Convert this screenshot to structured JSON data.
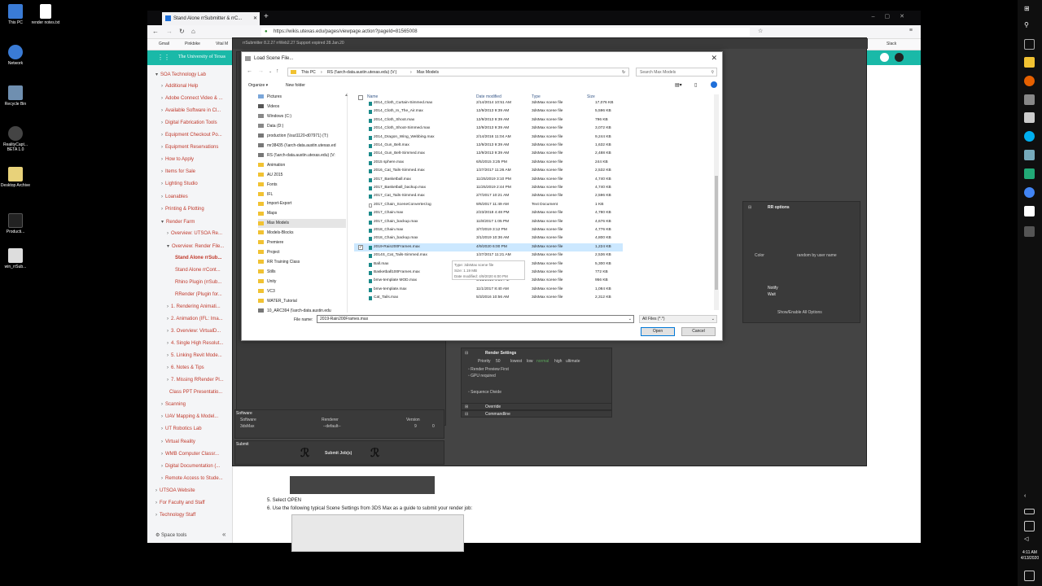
{
  "desktop": {
    "icons": [
      {
        "label": "This PC",
        "icon": "monitor-icon",
        "color": "#3a7bd5"
      },
      {
        "label": "Network",
        "icon": "network-icon",
        "color": "#3a7bd5"
      },
      {
        "label": "Recycle Bin",
        "icon": "recycle-bin-icon",
        "color": "#6f8fb0"
      },
      {
        "label": "RealityCapt... BETA 1.0",
        "icon": "realitycapture-icon",
        "color": "#444"
      },
      {
        "label": "Desktop Archive",
        "icon": "folder-icon",
        "color": "#e8d27a"
      },
      {
        "label": "Producti...",
        "icon": "app-icon",
        "color": "#222"
      },
      {
        "label": "win_rrSub...",
        "icon": "rrsubmitter-icon",
        "color": "#ddd"
      }
    ],
    "file_icon": {
      "label": "render notes.txt",
      "icon": "text-file-icon"
    }
  },
  "taskbar": {
    "clock_time": "4:11 AM",
    "clock_date": "4/13/2020"
  },
  "browser": {
    "tab_title": "Stand Alone rrSubmitter & rrC...",
    "new_tab": "+",
    "url": "https://wikis.utexas.edu/pages/viewpage.action?pageId=81565008",
    "bookmarks": [
      "Gmail",
      "Pinkbike",
      "Vital M"
    ],
    "slack_label": "Slack"
  },
  "wiki": {
    "header_title": "The University of Texas",
    "sidebar": [
      {
        "label": "SOA Technology Lab",
        "indent": 0,
        "arrow": "▾"
      },
      {
        "label": "Additional Help",
        "indent": 1,
        "arrow": "›"
      },
      {
        "label": "Adobe Connect Video & ...",
        "indent": 1,
        "arrow": "›"
      },
      {
        "label": "Available Software in Cl...",
        "indent": 1,
        "arrow": "›"
      },
      {
        "label": "Digital Fabrication Tools",
        "indent": 1,
        "arrow": "›"
      },
      {
        "label": "Equipment Checkout Po...",
        "indent": 1,
        "arrow": "›"
      },
      {
        "label": "Equipment Reservations",
        "indent": 1,
        "arrow": "›"
      },
      {
        "label": "How to Apply",
        "indent": 1,
        "arrow": "›"
      },
      {
        "label": "Items for Sale",
        "indent": 1,
        "arrow": "›"
      },
      {
        "label": "Lighting Studio",
        "indent": 1,
        "arrow": "›"
      },
      {
        "label": "Loanables",
        "indent": 1,
        "arrow": "›"
      },
      {
        "label": "Printing & Plotting",
        "indent": 1,
        "arrow": "›"
      },
      {
        "label": "Render Farm",
        "indent": 1,
        "arrow": "▾"
      },
      {
        "label": "Overview: UTSOA Re...",
        "indent": 2,
        "arrow": "›"
      },
      {
        "label": "Overview: Render File...",
        "indent": 2,
        "arrow": "▾"
      },
      {
        "label": "Stand Alone rrSub...",
        "indent": 3,
        "arrow": "",
        "bold": true
      },
      {
        "label": "Stand Alone rrCont...",
        "indent": 3,
        "arrow": ""
      },
      {
        "label": "Rhino Plugin (rrSub...",
        "indent": 3,
        "arrow": ""
      },
      {
        "label": "RRender (Plugin for...",
        "indent": 3,
        "arrow": ""
      },
      {
        "label": "1. Rendering Animati...",
        "indent": 2,
        "arrow": "›"
      },
      {
        "label": "2. Animation (IFL: Ima...",
        "indent": 2,
        "arrow": "›"
      },
      {
        "label": "3. Overview: VirtualD...",
        "indent": 2,
        "arrow": "›"
      },
      {
        "label": "4. Single High Resolut...",
        "indent": 2,
        "arrow": "›"
      },
      {
        "label": "5. Linking Revit Mode...",
        "indent": 2,
        "arrow": "›"
      },
      {
        "label": "6. Notes & Tips",
        "indent": 2,
        "arrow": "›"
      },
      {
        "label": "7. Missing RRender Pl...",
        "indent": 2,
        "arrow": "›"
      },
      {
        "label": "Class PPT Presentatio...",
        "indent": 2,
        "arrow": ""
      },
      {
        "label": "Scanning",
        "indent": 1,
        "arrow": "›"
      },
      {
        "label": "UAV Mapping & Model...",
        "indent": 1,
        "arrow": "›"
      },
      {
        "label": "UT Robotics Lab",
        "indent": 1,
        "arrow": "›"
      },
      {
        "label": "Virtual Reality",
        "indent": 1,
        "arrow": "›"
      },
      {
        "label": "WMB Computer Classr...",
        "indent": 1,
        "arrow": "›"
      },
      {
        "label": "Digital Documentation (...",
        "indent": 1,
        "arrow": "›"
      },
      {
        "label": "Remote Access to Stude...",
        "indent": 1,
        "arrow": "›"
      },
      {
        "label": "UTSOA Website",
        "indent": 0,
        "arrow": "›"
      },
      {
        "label": "For Faculty and Staff",
        "indent": 0,
        "arrow": "›"
      },
      {
        "label": "Technology Staff",
        "indent": 0,
        "arrow": "›"
      }
    ],
    "space_tools": "Space tools",
    "step5": "5. Select OPEN",
    "step6": "6. Use the following typical Scene Settings from 3DS Max as a guide to submit your render job:"
  },
  "rrsubmitter": {
    "title": "rrSubmitter  8.2.27     rrWeb2.27     Support expired 28.Jan.20",
    "rr_options": "RR options",
    "color_label": "Color",
    "color_value": "random by user name",
    "notify": "Notify",
    "wait": "Wait",
    "show_enable_all": "Show/Enable All Options",
    "render_settings": "Render Settings",
    "priority_label": "Priority",
    "priority_value": "50",
    "priority_levels": [
      "lowest",
      "low",
      "normal",
      "high",
      "ultimate"
    ],
    "render_preview_first": "Render Preview First",
    "gpu_required": "GPU required",
    "sequence_divide": "Sequence Divide",
    "override": "Override",
    "commandline": "Commandline",
    "software_section": "Software",
    "software_label": "Software",
    "software_value": "3dsMax",
    "renderer_label": "Renderer",
    "renderer_value": "--default--",
    "version_label": "Version",
    "version_value": "9",
    "version_value2": "0",
    "submit_section": "Submit",
    "submit_button": "Submit Job(s)"
  },
  "dialog": {
    "title": "Load Scene File...",
    "breadcrumb": [
      "This PC",
      "RS (\\\\arch-data.austin.utexas.edu) (V:)",
      "Max Models"
    ],
    "search_placeholder": "Search Max Models",
    "organize": "Organize ▾",
    "new_folder": "New folder",
    "tree": [
      {
        "label": "Pictures",
        "kind": "pictures"
      },
      {
        "label": "Videos",
        "kind": "videos"
      },
      {
        "label": "Windows (C:)",
        "kind": "drive"
      },
      {
        "label": "Data (D:)",
        "kind": "drive"
      },
      {
        "label": "production (\\\\sut1120-d07971) (T:)",
        "kind": "net"
      },
      {
        "label": "mr38435 (\\\\arch-data.austin.utexas.ed",
        "kind": "net"
      },
      {
        "label": "RS (\\\\arch-data.austin.utexas.edu) (V:",
        "kind": "net"
      },
      {
        "label": "Animation",
        "kind": "folder"
      },
      {
        "label": "AU 2015",
        "kind": "folder"
      },
      {
        "label": "Fonts",
        "kind": "folder"
      },
      {
        "label": "IFL",
        "kind": "folder"
      },
      {
        "label": "Import-Export",
        "kind": "folder"
      },
      {
        "label": "Maps",
        "kind": "folder"
      },
      {
        "label": "Max Models",
        "kind": "folder",
        "selected": true
      },
      {
        "label": "Models-Blocks",
        "kind": "folder"
      },
      {
        "label": "Premiere",
        "kind": "folder"
      },
      {
        "label": "Project",
        "kind": "folder"
      },
      {
        "label": "RR Training Class",
        "kind": "folder"
      },
      {
        "label": "Stills",
        "kind": "folder"
      },
      {
        "label": "Unity",
        "kind": "folder"
      },
      {
        "label": "VC3",
        "kind": "folder"
      },
      {
        "label": "WATER_Tutorial",
        "kind": "folder"
      },
      {
        "label": "10_ARC394 (\\\\arch-data.austin.edu",
        "kind": "net"
      }
    ],
    "columns": [
      "Name",
      "Date modified",
      "Type",
      "Size"
    ],
    "files": [
      {
        "name": "2014_Cloth_Curtain-Simmed.max",
        "date": "2/14/2014 10:51 AM",
        "type": "3dsMax scene file",
        "size": "17,076 KB"
      },
      {
        "name": "2014_Cloth_In_The_Air.max",
        "date": "12/9/2013 9:39 AM",
        "type": "3dsMax scene file",
        "size": "5,596 KB"
      },
      {
        "name": "2014_Cloth_Shoot.max",
        "date": "12/9/2013 9:39 AM",
        "type": "3dsMax scene file",
        "size": "796 KB"
      },
      {
        "name": "2014_Cloth_Shoot-Simmed.max",
        "date": "12/9/2013 9:39 AM",
        "type": "3dsMax scene file",
        "size": "3,072 KB"
      },
      {
        "name": "2014_Dragon_Wing_Webbing.max",
        "date": "2/14/2016 11:04 AM",
        "type": "3dsMax scene file",
        "size": "9,244 KB"
      },
      {
        "name": "2014_Gun_Belt.max",
        "date": "12/9/2013 9:39 AM",
        "type": "3dsMax scene file",
        "size": "1,632 KB"
      },
      {
        "name": "2014_Gun_Belt-Simmed.max",
        "date": "12/9/2013 9:39 AM",
        "type": "3dsMax scene file",
        "size": "2,488 KB"
      },
      {
        "name": "2015 sphere.max",
        "date": "6/5/2015 3:25 PM",
        "type": "3dsMax scene file",
        "size": "244 KB"
      },
      {
        "name": "2016_Cat_Tails-Simmed.max",
        "date": "1/27/2017 11:26 AM",
        "type": "3dsMax scene file",
        "size": "2,532 KB"
      },
      {
        "name": "2017_Basketball.max",
        "date": "11/25/2019 3:10 PM",
        "type": "3dsMax scene file",
        "size": "4,740 KB"
      },
      {
        "name": "2017_Basketball_backup.max",
        "date": "11/25/2019 2:44 PM",
        "type": "3dsMax scene file",
        "size": "4,740 KB"
      },
      {
        "name": "2017_Cat_Tails-Simmed.max",
        "date": "2/7/2017 10:21 AM",
        "type": "3dsMax scene file",
        "size": "2,596 KB"
      },
      {
        "name": "2017_Chain_SceneConverter.log",
        "date": "9/6/2017 11:49 AM",
        "type": "Text Document",
        "size": "1 KB"
      },
      {
        "name": "2017_Chain.max",
        "date": "2/23/2018 4:48 PM",
        "type": "3dsMax scene file",
        "size": "4,780 KB"
      },
      {
        "name": "2017_Chain_backup.max",
        "date": "11/8/2017 1:05 PM",
        "type": "3dsMax scene file",
        "size": "4,676 KB"
      },
      {
        "name": "2018_Chain.max",
        "date": "3/7/2019 3:12 PM",
        "type": "3dsMax scene file",
        "size": "4,776 KB"
      },
      {
        "name": "2018_Chain_backup.max",
        "date": "3/1/2019 10:36 AM",
        "type": "3dsMax scene file",
        "size": "4,800 KB"
      },
      {
        "name": "2019-Rain200Frames.max",
        "date": "4/9/2020 6:00 PM",
        "type": "3dsMax scene file",
        "size": "1,224 KB",
        "selected": true
      },
      {
        "name": "2014S_Cat_Tails-Simmed.max",
        "date": "1/27/2017 11:21 AM",
        "type": "3dsMax scene file",
        "size": "2,536 KB"
      },
      {
        "name": "Ball.max",
        "date": "",
        "type": "3dsMax scene file",
        "size": "5,300 KB"
      },
      {
        "name": "Basketball100Frames.max",
        "date": "2/5/2020 11:38 AM",
        "type": "3dsMax scene file",
        "size": "772 KB"
      },
      {
        "name": "bmw-template MOD.max",
        "date": "9/15/2014 4:56 PM",
        "type": "3dsMax scene file",
        "size": "956 KB"
      },
      {
        "name": "bmw-template.max",
        "date": "11/1/2017 8:40 AM",
        "type": "3dsMax scene file",
        "size": "1,084 KB"
      },
      {
        "name": "Cat_Tails.max",
        "date": "5/3/2016 10:56 AM",
        "type": "3dsMax scene file",
        "size": "2,312 KB"
      }
    ],
    "tooltip_type": "Type: 3dsMax scene file",
    "tooltip_size": "Size: 1.19 MB",
    "tooltip_date": "Date modified: 4/9/2020 6:00 PM",
    "filename_label": "File name:",
    "filename_value": "2019-Rain200Frames.max",
    "filter_value": "All Files (*.*)",
    "open_button": "Open",
    "cancel_button": "Cancel"
  }
}
